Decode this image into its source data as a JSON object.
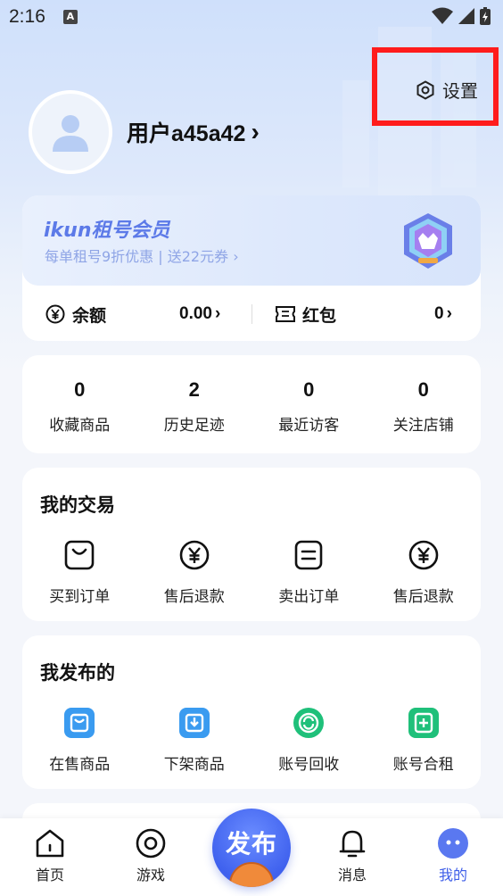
{
  "status_bar": {
    "time": "2:16",
    "notification_icon": "A"
  },
  "header": {
    "settings_label": "设置"
  },
  "profile": {
    "username": "用户a45a42",
    "chevron": "›"
  },
  "vip": {
    "title": "ikun租号会员",
    "subtitle": "每单租号9折优惠 | 送22元券 ›",
    "balance_label": "余额",
    "balance_value": "0.00",
    "redpacket_label": "红包",
    "redpacket_value": "0"
  },
  "stats": [
    {
      "value": "0",
      "label": "收藏商品"
    },
    {
      "value": "2",
      "label": "历史足迹"
    },
    {
      "value": "0",
      "label": "最近访客"
    },
    {
      "value": "0",
      "label": "关注店铺"
    }
  ],
  "trade": {
    "title": "我的交易",
    "items": [
      {
        "label": "买到订单",
        "icon": "bag-icon"
      },
      {
        "label": "售后退款",
        "icon": "yuan-circle-icon"
      },
      {
        "label": "卖出订单",
        "icon": "document-icon"
      },
      {
        "label": "售后退款",
        "icon": "yuan-circle-icon"
      }
    ]
  },
  "publish": {
    "title": "我发布的",
    "items": [
      {
        "label": "在售商品",
        "icon": "shop-icon",
        "color": "#3a9bf0"
      },
      {
        "label": "下架商品",
        "icon": "download-box-icon",
        "color": "#3a9bf0"
      },
      {
        "label": "账号回收",
        "icon": "recycle-icon",
        "color": "#1fc07a"
      },
      {
        "label": "账号合租",
        "icon": "add-box-icon",
        "color": "#1fc07a"
      }
    ]
  },
  "nav": {
    "items": [
      {
        "label": "首页"
      },
      {
        "label": "游戏"
      },
      {
        "label": "消息"
      },
      {
        "label": "我的"
      }
    ],
    "publish_label": "发布",
    "active_color": "#3d5de8"
  }
}
